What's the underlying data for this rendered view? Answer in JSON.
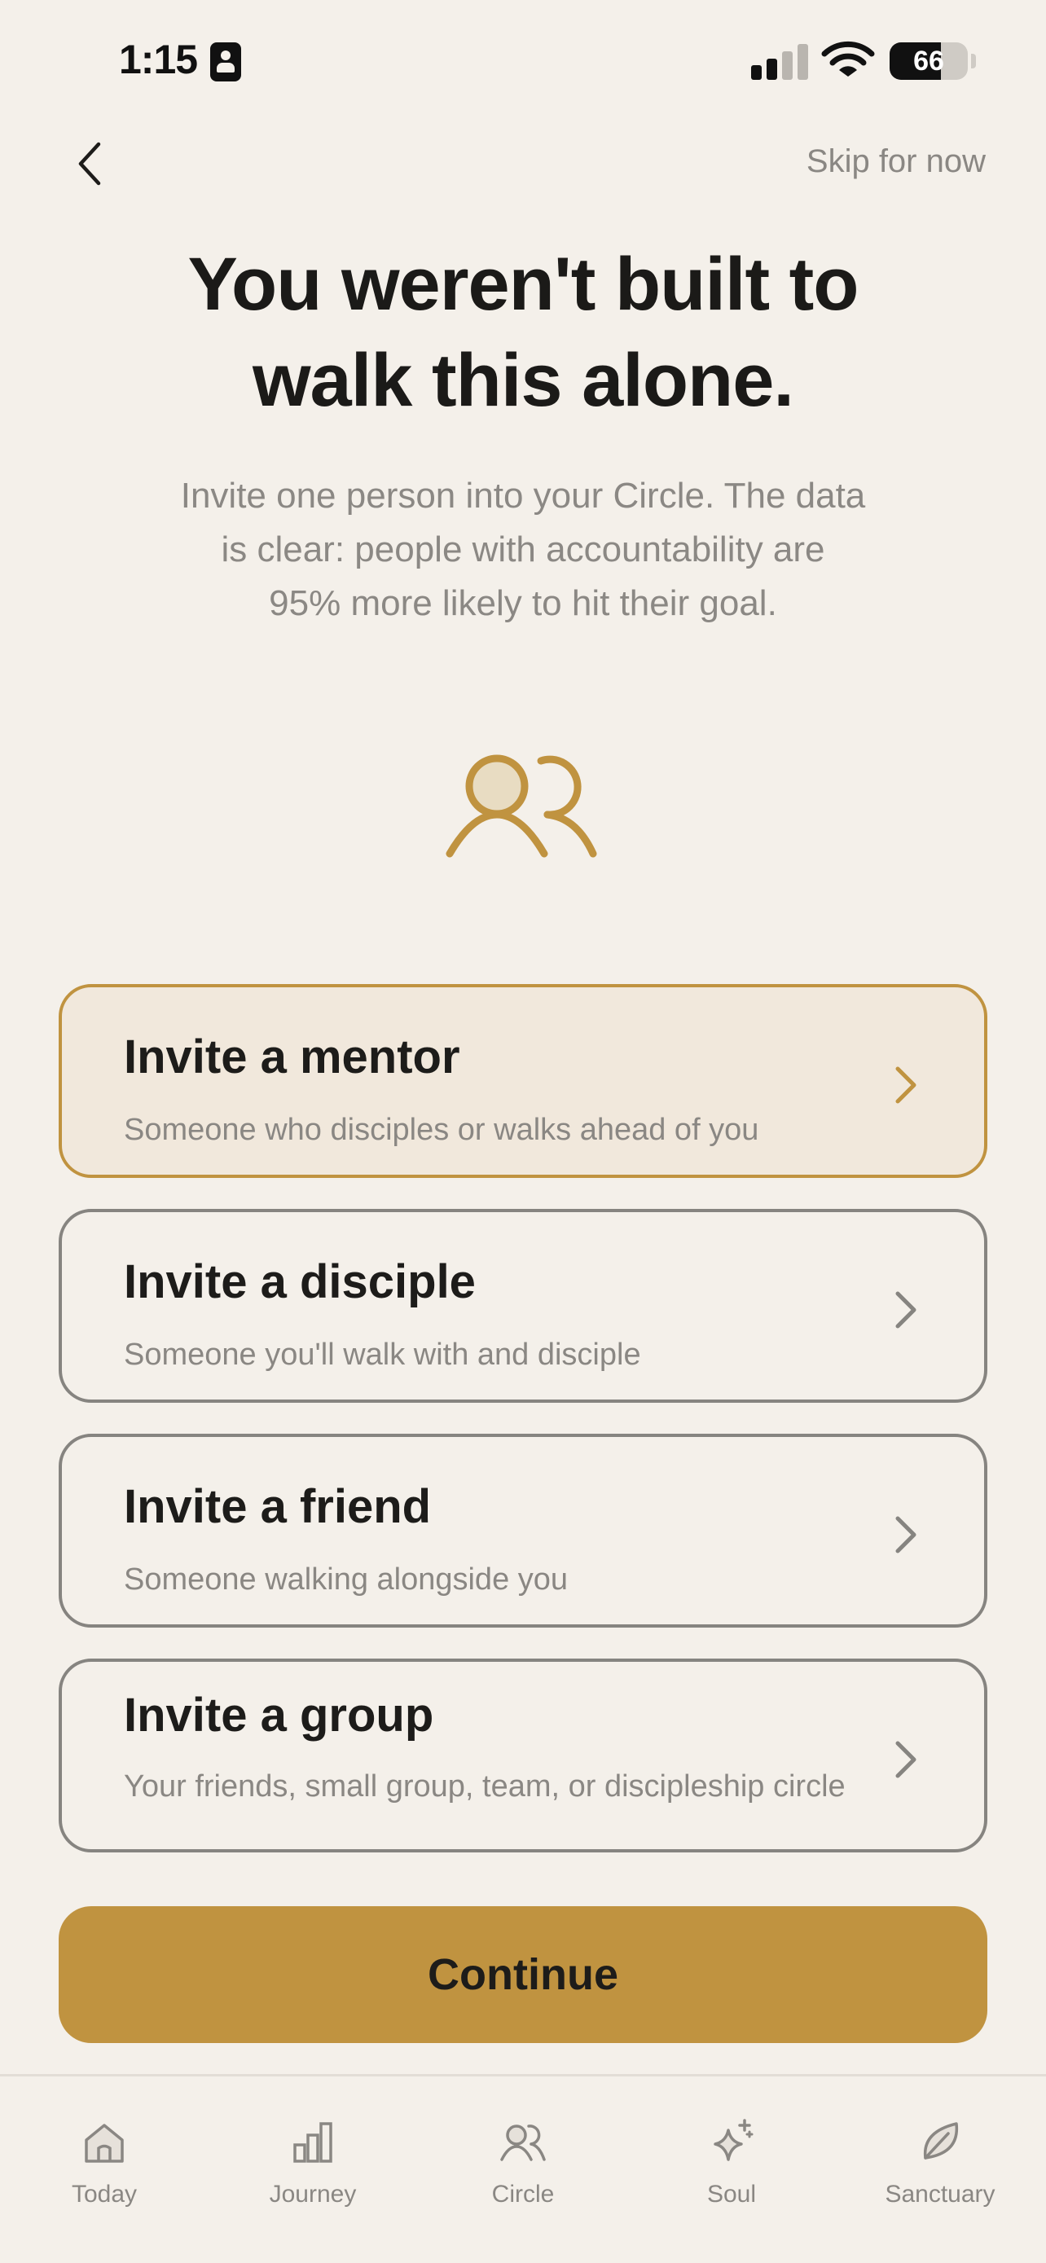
{
  "status_bar": {
    "time": "1:15",
    "battery": "66",
    "battery_level": 0.66,
    "signal_bars_active": 2,
    "signal_bars_total": 4
  },
  "header": {
    "back_icon": "chevron-left-icon",
    "skip_label": "Skip for now"
  },
  "headline": {
    "line1": "You weren't built to",
    "line2": "walk this alone."
  },
  "subtext": {
    "line1": "Invite one person into your Circle. The data",
    "line2": "is clear: people with accountability are",
    "line3": "95% more likely to hit their goal."
  },
  "hero_icon": "people-icon",
  "options": [
    {
      "title": "Invite a mentor",
      "description": "Someone who disciples or walks ahead of you",
      "selected": true
    },
    {
      "title": "Invite a disciple",
      "description": "Someone you'll walk with and disciple",
      "selected": false
    },
    {
      "title": "Invite a friend",
      "description": "Someone walking alongside you",
      "selected": false
    },
    {
      "title": "Invite a group",
      "description": "Your friends, small group, team, or discipleship circle",
      "selected": false
    }
  ],
  "continue_label": "Continue",
  "tabs": [
    {
      "label": "Today",
      "icon": "home-icon"
    },
    {
      "label": "Journey",
      "icon": "bar-chart-icon"
    },
    {
      "label": "Circle",
      "icon": "people-icon"
    },
    {
      "label": "Soul",
      "icon": "sparkle-icon"
    },
    {
      "label": "Sanctuary",
      "icon": "leaf-icon"
    }
  ],
  "colors": {
    "background": "#f4f0ea",
    "accent": "#c09340",
    "selected_card_bg": "#f1e8dc",
    "text_primary": "#1d1c1a",
    "text_secondary": "#8a8783"
  }
}
